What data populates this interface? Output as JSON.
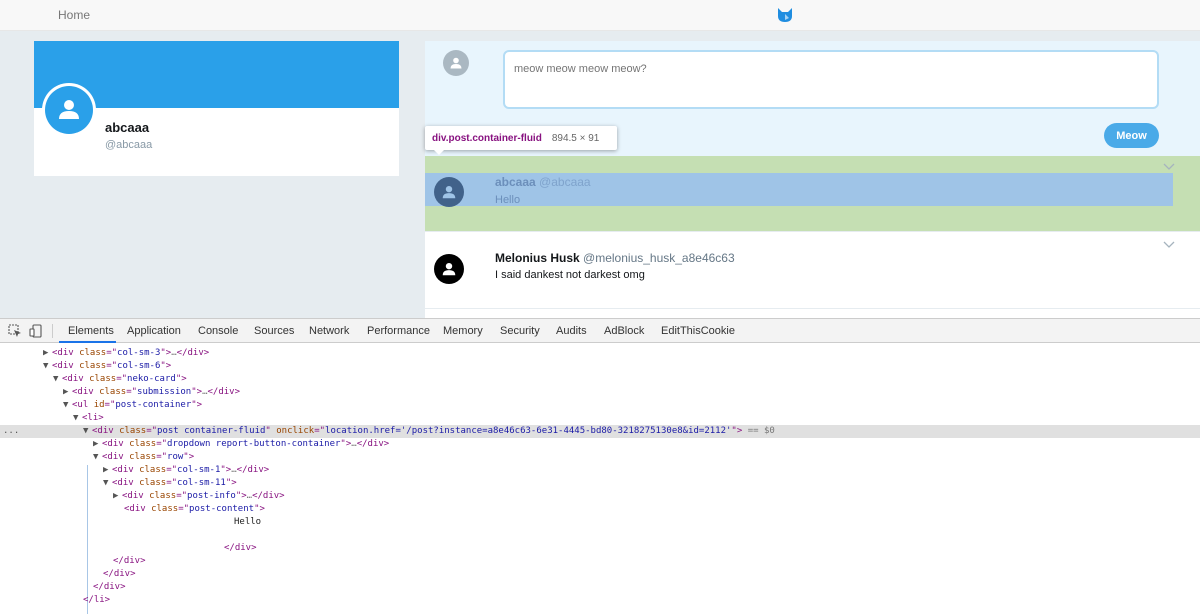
{
  "navbar": {
    "home_label": "Home",
    "logo_icon": "cat-logo-icon"
  },
  "profile": {
    "name": "abcaaa",
    "handle": "@abcaaa"
  },
  "submission": {
    "placeholder": "meow meow meow meow?",
    "button_label": "Meow"
  },
  "posts": [
    {
      "name": "abcaaa",
      "handle": "@abcaaa",
      "content": "Hello"
    },
    {
      "name": "Melonius Husk",
      "handle": "@melonius_husk_a8e46c63",
      "content": "I said dankest not darkest omg"
    }
  ],
  "tooltip": {
    "selector": "div.post.container-fluid",
    "size": "894.5 × 91"
  },
  "devtools": {
    "tabs": [
      "Elements",
      "Application",
      "Console",
      "Sources",
      "Network",
      "Performance",
      "Memory",
      "Security",
      "Audits",
      "AdBlock",
      "EditThisCookie"
    ],
    "active_tab": "Elements",
    "dom": {
      "l1_cls": "col-sm-3",
      "l2_cls": "col-sm-6",
      "l3_cls": "neko-card",
      "l4_cls": "submission",
      "l5_id": "post-container",
      "l6_tag": "li",
      "l7_cls": "post container-fluid",
      "l7_onclick": "location.href='/post?instance=a8e46c63-6e31-4445-bd80-3218275130e8&id=2112'",
      "l7_eq": "== $0",
      "l8_cls": "dropdown report-button-container",
      "l9_cls": "row",
      "l10_cls": "col-sm-1",
      "l11_cls": "col-sm-11",
      "l12_cls": "post-info",
      "l13_cls": "post-content",
      "l14_text": "Hello",
      "ellipsis": "…",
      "row_dots": "..."
    }
  }
}
